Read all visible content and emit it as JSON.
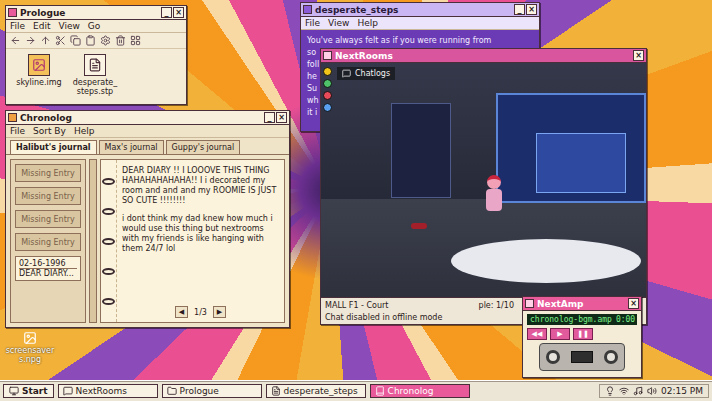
{
  "desktop_icons": [
    {
      "label": "screensavers.npg"
    }
  ],
  "prologue": {
    "title": "Prologue",
    "controls": [
      "_",
      "×"
    ],
    "menu": [
      "File",
      "Edit",
      "View",
      "Go"
    ],
    "files": [
      {
        "label": "skyline.img",
        "kind": "image"
      },
      {
        "label": "desperate_steps.stp",
        "kind": "document"
      }
    ]
  },
  "desperate_steps": {
    "title": "desperate_steps",
    "controls": [
      "_",
      "×"
    ],
    "menu": [
      "File",
      "View",
      "Help"
    ],
    "lines": [
      "You've always felt as if you were running from",
      "so",
      "foll",
      "he",
      "Su",
      "wh",
      "it i"
    ]
  },
  "chronolog": {
    "title": "Chronolog",
    "controls": [
      "_",
      "×"
    ],
    "menu": [
      "File",
      "Sort By",
      "Help"
    ],
    "tabs": [
      {
        "label": "Halibut's journal",
        "selected": true
      },
      {
        "label": "Max's journal",
        "selected": false
      },
      {
        "label": "Guppy's journal",
        "selected": false
      }
    ],
    "entries": [
      {
        "label": "Missing Entry",
        "selected": false
      },
      {
        "label": "Missing Entry",
        "selected": false
      },
      {
        "label": "Missing Entry",
        "selected": false
      },
      {
        "label": "Missing Entry",
        "selected": false
      },
      {
        "date": "02-16-1996",
        "label": "DEAR DIARY...",
        "selected": true
      }
    ],
    "page": {
      "paragraphs": [
        "DEAR DIARY !! I LOOOVE THIS THING HAHAHAHAHAHA!! I i decorated my room and and and my ROOMIE IS JUST SO CUTE !!!!!!!!",
        "i dont think my dad knew how much i would use this thing but nextrooms with my friends is like hanging with them 24/7 lol"
      ],
      "prev": "◀",
      "count": "1/3",
      "next": "▶"
    }
  },
  "nextrooms": {
    "title": "NextRooms",
    "controls": [
      "×"
    ],
    "chatlogs": "Chatlogs",
    "location": "MALL F1 - Court",
    "notice": "Chat disabled in offline mode",
    "people": "ple: 1/10"
  },
  "nextamp": {
    "title": "NextAmp",
    "controls": [
      "×"
    ],
    "track": "chronolog-bgm.amp",
    "time": "0:00",
    "buttons": [
      "◀◀",
      "▶",
      "❚❚"
    ]
  },
  "taskbar": {
    "start": "Start",
    "tasks": [
      {
        "label": "NextRooms",
        "selected": false
      },
      {
        "label": "Prologue",
        "selected": false
      },
      {
        "label": "desperate_steps",
        "selected": false
      },
      {
        "label": "Chronolog",
        "selected": true
      }
    ],
    "time": "02:15 PM"
  }
}
